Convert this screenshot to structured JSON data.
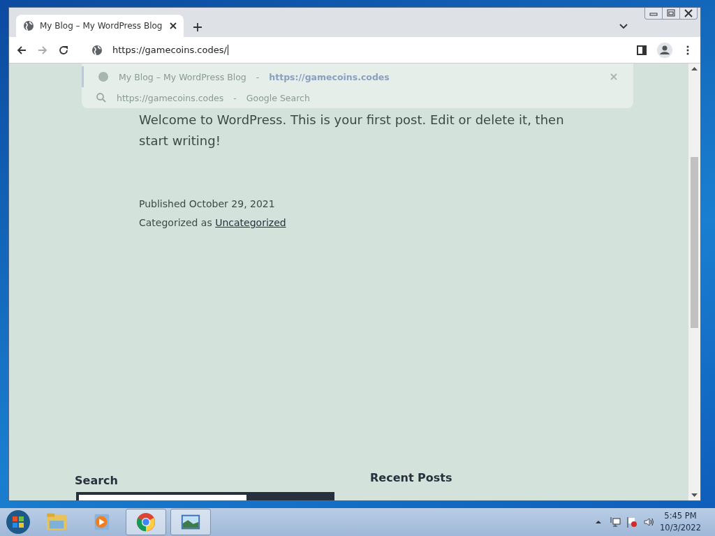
{
  "browser": {
    "tab": {
      "title": "My Blog – My WordPress Blog",
      "selected": true
    },
    "address": "https://gamecoins.codes/",
    "suggestions": [
      {
        "kind": "page",
        "title": "My Blog – My WordPress Blog",
        "separator": "-",
        "detail": "https://gamecoins.codes",
        "selected": true
      },
      {
        "kind": "search",
        "title": "https://gamecoins.codes",
        "separator": "-",
        "detail": "Google Search",
        "selected": false
      }
    ]
  },
  "post": {
    "body": "Welcome to WordPress. This is your first post. Edit or delete it, then start writing!",
    "published": "Published October 29, 2021",
    "category_label": "Categorized as",
    "category": "Uncategorized"
  },
  "widgets": [
    {
      "kind": "search",
      "title": "Search"
    },
    {
      "kind": "list",
      "title": "Recent Posts"
    }
  ],
  "taskbar": {
    "apps": [
      {
        "kind": "folder",
        "selected": false
      },
      {
        "kind": "media",
        "selected": false
      },
      {
        "kind": "browser",
        "selected": true
      },
      {
        "kind": "photos",
        "selected": true
      }
    ],
    "time": "5:45 PM",
    "date": "10/3/2022"
  }
}
